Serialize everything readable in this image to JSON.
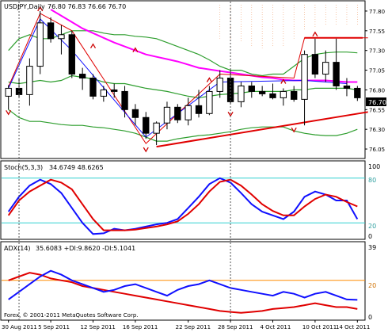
{
  "header": {
    "symbol": "USDJPY,Daily",
    "ohlc": "76.80 76.83 76.66 76.70",
    "last_price": "76.70"
  },
  "indicators": {
    "stoch": {
      "title": "Stoch(5,3,3)",
      "values": "34.6749 48.6265",
      "upper_level": "80",
      "lower_level": "20",
      "scale_top": "100",
      "scale_bottom": "0"
    },
    "adx": {
      "title": "ADX(14)",
      "values": "35.6083 +DI:9.8620 -DI:5.1041",
      "level": "20",
      "scale_top": "39",
      "scale_bottom": "0"
    }
  },
  "copyright": "Forex, © 2001-2011 MetaQuotes Software Corp.",
  "colors": {
    "bull": "#ffffff",
    "bear": "#000000",
    "ma_magenta": "#ff00ff",
    "ma_green": "#2e9e2e",
    "red": "#e00000",
    "blue": "#1010ff",
    "ichimoku_fill": "#f0a070",
    "level_cyan": "#30d0d0",
    "level_orange": "#ff8c00",
    "fractal": "#cc0000"
  },
  "chart_data": [
    {
      "type": "candlestick",
      "title": "USDJPY,Daily",
      "y_ticks": [
        "77.80",
        "77.55",
        "77.30",
        "77.05",
        "76.80",
        "76.55",
        "76.30",
        "76.05"
      ],
      "ylim": [
        75.95,
        77.9
      ],
      "x_ticks": [
        "30 Aug 2011",
        "5 Sep 2011",
        "12 Sep 2011",
        "16 Sep 2011",
        "22 Sep 2011",
        "28 Sep 2011",
        "4 Oct 2011",
        "10 Oct 2011",
        "14 Oct 2011"
      ],
      "candles": [
        {
          "o": 76.72,
          "h": 76.86,
          "l": 76.55,
          "c": 76.82
        },
        {
          "o": 76.82,
          "h": 76.95,
          "l": 76.7,
          "c": 76.74
        },
        {
          "o": 76.74,
          "h": 77.2,
          "l": 76.6,
          "c": 77.1
        },
        {
          "o": 77.1,
          "h": 77.8,
          "l": 77.0,
          "c": 77.65
        },
        {
          "o": 77.65,
          "h": 77.72,
          "l": 77.4,
          "c": 77.45
        },
        {
          "o": 77.45,
          "h": 77.62,
          "l": 77.25,
          "c": 77.5
        },
        {
          "o": 77.5,
          "h": 77.55,
          "l": 76.95,
          "c": 77.0
        },
        {
          "o": 77.0,
          "h": 77.08,
          "l": 76.8,
          "c": 76.95
        },
        {
          "o": 76.95,
          "h": 77.0,
          "l": 76.68,
          "c": 76.72
        },
        {
          "o": 76.72,
          "h": 76.85,
          "l": 76.65,
          "c": 76.8
        },
        {
          "o": 76.8,
          "h": 76.88,
          "l": 76.7,
          "c": 76.78
        },
        {
          "o": 76.78,
          "h": 76.85,
          "l": 76.45,
          "c": 76.55
        },
        {
          "o": 76.55,
          "h": 76.62,
          "l": 76.35,
          "c": 76.45
        },
        {
          "o": 76.45,
          "h": 76.52,
          "l": 76.18,
          "c": 76.25
        },
        {
          "o": 76.25,
          "h": 76.4,
          "l": 76.1,
          "c": 76.38
        },
        {
          "o": 76.38,
          "h": 76.65,
          "l": 76.3,
          "c": 76.58
        },
        {
          "o": 76.58,
          "h": 76.62,
          "l": 76.38,
          "c": 76.42
        },
        {
          "o": 76.42,
          "h": 76.7,
          "l": 76.35,
          "c": 76.6
        },
        {
          "o": 76.6,
          "h": 76.8,
          "l": 76.45,
          "c": 76.5
        },
        {
          "o": 76.5,
          "h": 76.85,
          "l": 76.48,
          "c": 76.78
        },
        {
          "o": 76.78,
          "h": 77.05,
          "l": 76.7,
          "c": 76.95
        },
        {
          "o": 76.95,
          "h": 77.05,
          "l": 76.62,
          "c": 76.65
        },
        {
          "o": 76.65,
          "h": 76.9,
          "l": 76.58,
          "c": 76.85
        },
        {
          "o": 76.85,
          "h": 76.9,
          "l": 76.7,
          "c": 76.78
        },
        {
          "o": 76.78,
          "h": 76.85,
          "l": 76.72,
          "c": 76.75
        },
        {
          "o": 76.75,
          "h": 76.88,
          "l": 76.68,
          "c": 76.7
        },
        {
          "o": 76.7,
          "h": 76.82,
          "l": 76.6,
          "c": 76.78
        },
        {
          "o": 76.78,
          "h": 76.85,
          "l": 76.65,
          "c": 76.68
        },
        {
          "o": 76.68,
          "h": 77.3,
          "l": 76.35,
          "c": 77.25
        },
        {
          "o": 77.25,
          "h": 77.45,
          "l": 76.95,
          "c": 77.0
        },
        {
          "o": 77.0,
          "h": 77.3,
          "l": 76.9,
          "c": 77.15
        },
        {
          "o": 77.15,
          "h": 77.45,
          "l": 76.8,
          "c": 76.85
        },
        {
          "o": 76.85,
          "h": 76.95,
          "l": 76.72,
          "c": 76.82
        },
        {
          "o": 76.82,
          "h": 76.85,
          "l": 76.66,
          "c": 76.7
        }
      ],
      "ma_magenta": [
        null,
        null,
        null,
        null,
        77.82,
        77.74,
        77.66,
        77.58,
        77.52,
        77.46,
        77.4,
        77.35,
        77.3,
        77.25,
        77.22,
        77.19,
        77.16,
        77.12,
        77.08,
        77.06,
        77.04,
        77.02,
        77.0,
        76.98,
        76.96,
        76.95,
        76.93,
        76.92,
        76.92,
        76.92,
        76.92,
        76.91,
        76.9,
        76.9
      ],
      "band_upper": [
        77.3,
        77.45,
        77.5,
        77.45,
        77.45,
        77.5,
        77.55,
        77.55,
        77.55,
        77.52,
        77.5,
        77.5,
        77.48,
        77.47,
        77.45,
        77.4,
        77.35,
        77.3,
        77.25,
        77.18,
        77.1,
        77.05,
        77.05,
        77.0,
        76.98,
        77.0,
        77.0,
        77.1,
        77.2,
        77.25,
        77.27,
        77.28,
        77.28,
        77.27
      ],
      "band_mid": [
        76.9,
        76.88,
        76.9,
        76.92,
        76.9,
        76.92,
        76.98,
        76.96,
        76.94,
        76.9,
        76.88,
        76.88,
        76.85,
        76.82,
        76.8,
        76.78,
        76.75,
        76.72,
        76.7,
        76.72,
        76.74,
        76.75,
        76.76,
        76.78,
        76.78,
        76.78,
        76.78,
        76.8,
        76.8,
        76.82,
        76.82,
        76.82,
        76.82,
        76.8
      ],
      "band_lower": [
        76.55,
        76.45,
        76.4,
        76.4,
        76.38,
        76.36,
        76.35,
        76.35,
        76.33,
        76.32,
        76.3,
        76.28,
        76.25,
        76.2,
        76.15,
        76.15,
        76.18,
        76.2,
        76.22,
        76.23,
        76.25,
        76.27,
        76.3,
        76.32,
        76.33,
        76.33,
        76.33,
        76.28,
        76.25,
        76.23,
        76.22,
        76.22,
        76.25,
        76.3
      ],
      "red_envelope": [
        [
          0,
          76.84
        ],
        [
          3,
          77.77
        ],
        [
          6,
          77.55
        ],
        [
          13,
          76.12
        ],
        [
          20,
          77.0
        ],
        [
          27,
          76.95
        ],
        [
          28,
          77.46
        ],
        [
          34,
          77.46
        ]
      ],
      "blue_fast": [
        [
          0,
          76.82
        ],
        [
          3,
          77.7
        ],
        [
          6,
          77.3
        ],
        [
          13,
          76.2
        ],
        [
          20,
          76.9
        ],
        [
          28,
          76.92
        ],
        [
          32,
          76.88
        ]
      ],
      "trend_line": [
        [
          14,
          76.08
        ],
        [
          34,
          76.52
        ]
      ],
      "fractals_up": [
        [
          3,
          77.82
        ],
        [
          8,
          77.35
        ],
        [
          12,
          77.3
        ],
        [
          19,
          76.92
        ],
        [
          26,
          76.9
        ],
        [
          29,
          77.5
        ]
      ],
      "fractals_down": [
        [
          0,
          76.52
        ],
        [
          13,
          76.05
        ],
        [
          21,
          76.5
        ],
        [
          27,
          76.3
        ]
      ],
      "vlines": [
        1,
        21
      ]
    },
    {
      "type": "line",
      "title": "Stoch(5,3,3)",
      "ylim": [
        0,
        100
      ],
      "levels": [
        20,
        80
      ],
      "series": [
        {
          "name": "%K",
          "color": "#1010ff",
          "values": [
            35,
            55,
            70,
            78,
            72,
            60,
            40,
            20,
            5,
            6,
            12,
            10,
            12,
            15,
            18,
            20,
            25,
            40,
            55,
            72,
            80,
            74,
            60,
            45,
            35,
            30,
            25,
            35,
            55,
            62,
            58,
            50,
            50,
            25
          ]
        },
        {
          "name": "%D",
          "color": "#e00000",
          "values": [
            30,
            50,
            62,
            70,
            78,
            74,
            65,
            45,
            25,
            10,
            10,
            10,
            11,
            13,
            15,
            18,
            22,
            32,
            45,
            62,
            75,
            78,
            70,
            58,
            45,
            36,
            30,
            30,
            42,
            52,
            58,
            55,
            48,
            42
          ]
        }
      ]
    },
    {
      "type": "line",
      "title": "ADX(14)",
      "ylim": [
        0,
        39
      ],
      "levels": [
        20
      ],
      "series": [
        {
          "name": "ADX",
          "color": "#e00000",
          "values": [
            20,
            22,
            24,
            23,
            21,
            20,
            19,
            17,
            16,
            15,
            14,
            13,
            12,
            11,
            10,
            9,
            8,
            7,
            6,
            5,
            4,
            3.5,
            3,
            3.5,
            4,
            5,
            5.5,
            6,
            7,
            8,
            7,
            6,
            6,
            5
          ]
        },
        {
          "name": "+DI",
          "color": "#1010ff",
          "values": [
            10,
            14,
            18,
            22,
            25,
            23,
            20,
            18,
            16,
            14,
            15,
            17,
            18,
            16,
            14,
            12,
            15,
            17,
            18,
            20,
            18,
            16,
            15,
            14,
            13,
            12,
            14,
            13,
            11,
            13,
            14,
            12,
            10,
            9.8
          ]
        }
      ]
    }
  ]
}
